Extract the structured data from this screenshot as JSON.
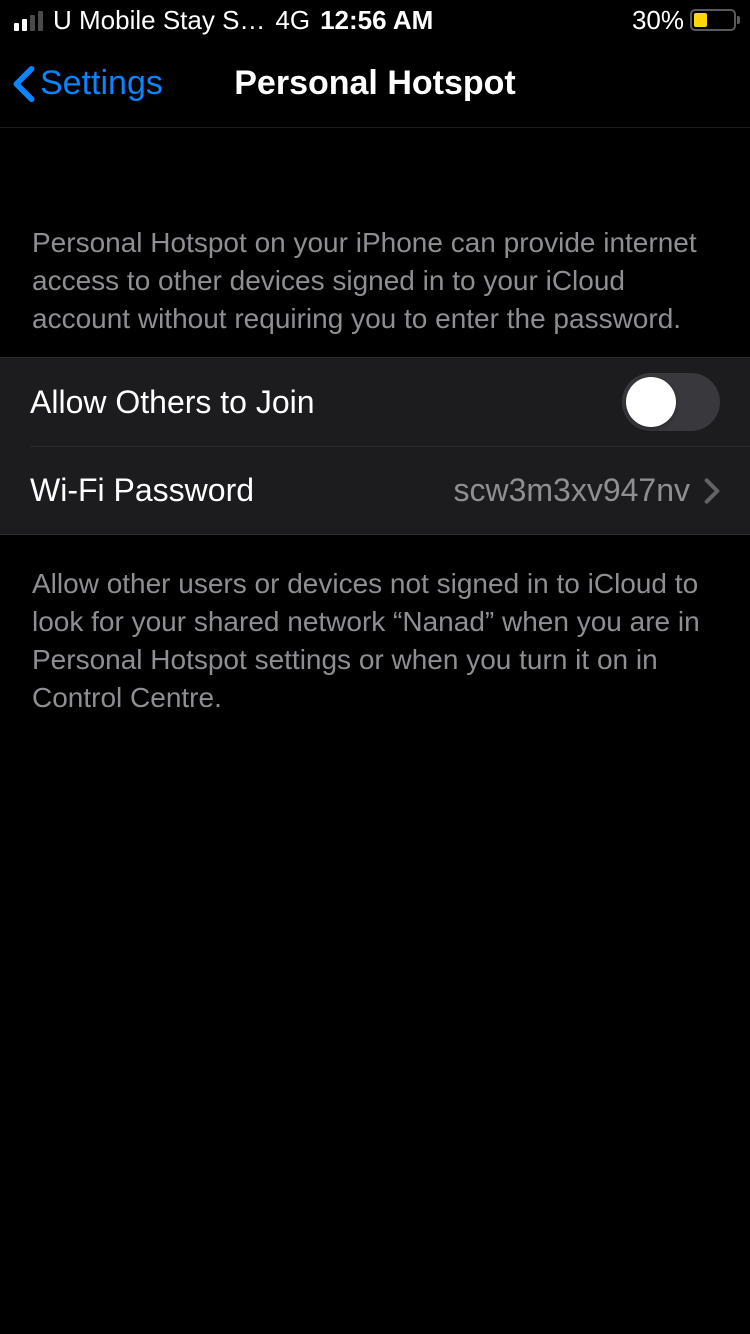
{
  "status_bar": {
    "carrier": "U Mobile Stay S…",
    "network": "4G",
    "time": "12:56 AM",
    "battery_pct": "30%"
  },
  "nav": {
    "back_label": "Settings",
    "title": "Personal Hotspot"
  },
  "sections": {
    "intro_text": "Personal Hotspot on your iPhone can provide internet access to other devices signed in to your iCloud account without requiring you to enter the password.",
    "footer_text": "Allow other users or devices not signed in to iCloud to look for your shared network “Nanad” when you are in Personal Hotspot settings or when you turn it on in Control Centre."
  },
  "rows": {
    "allow_others_label": "Allow Others to Join",
    "allow_others_on": false,
    "wifi_password_label": "Wi-Fi Password",
    "wifi_password_value": "scw3m3xv947nv"
  }
}
